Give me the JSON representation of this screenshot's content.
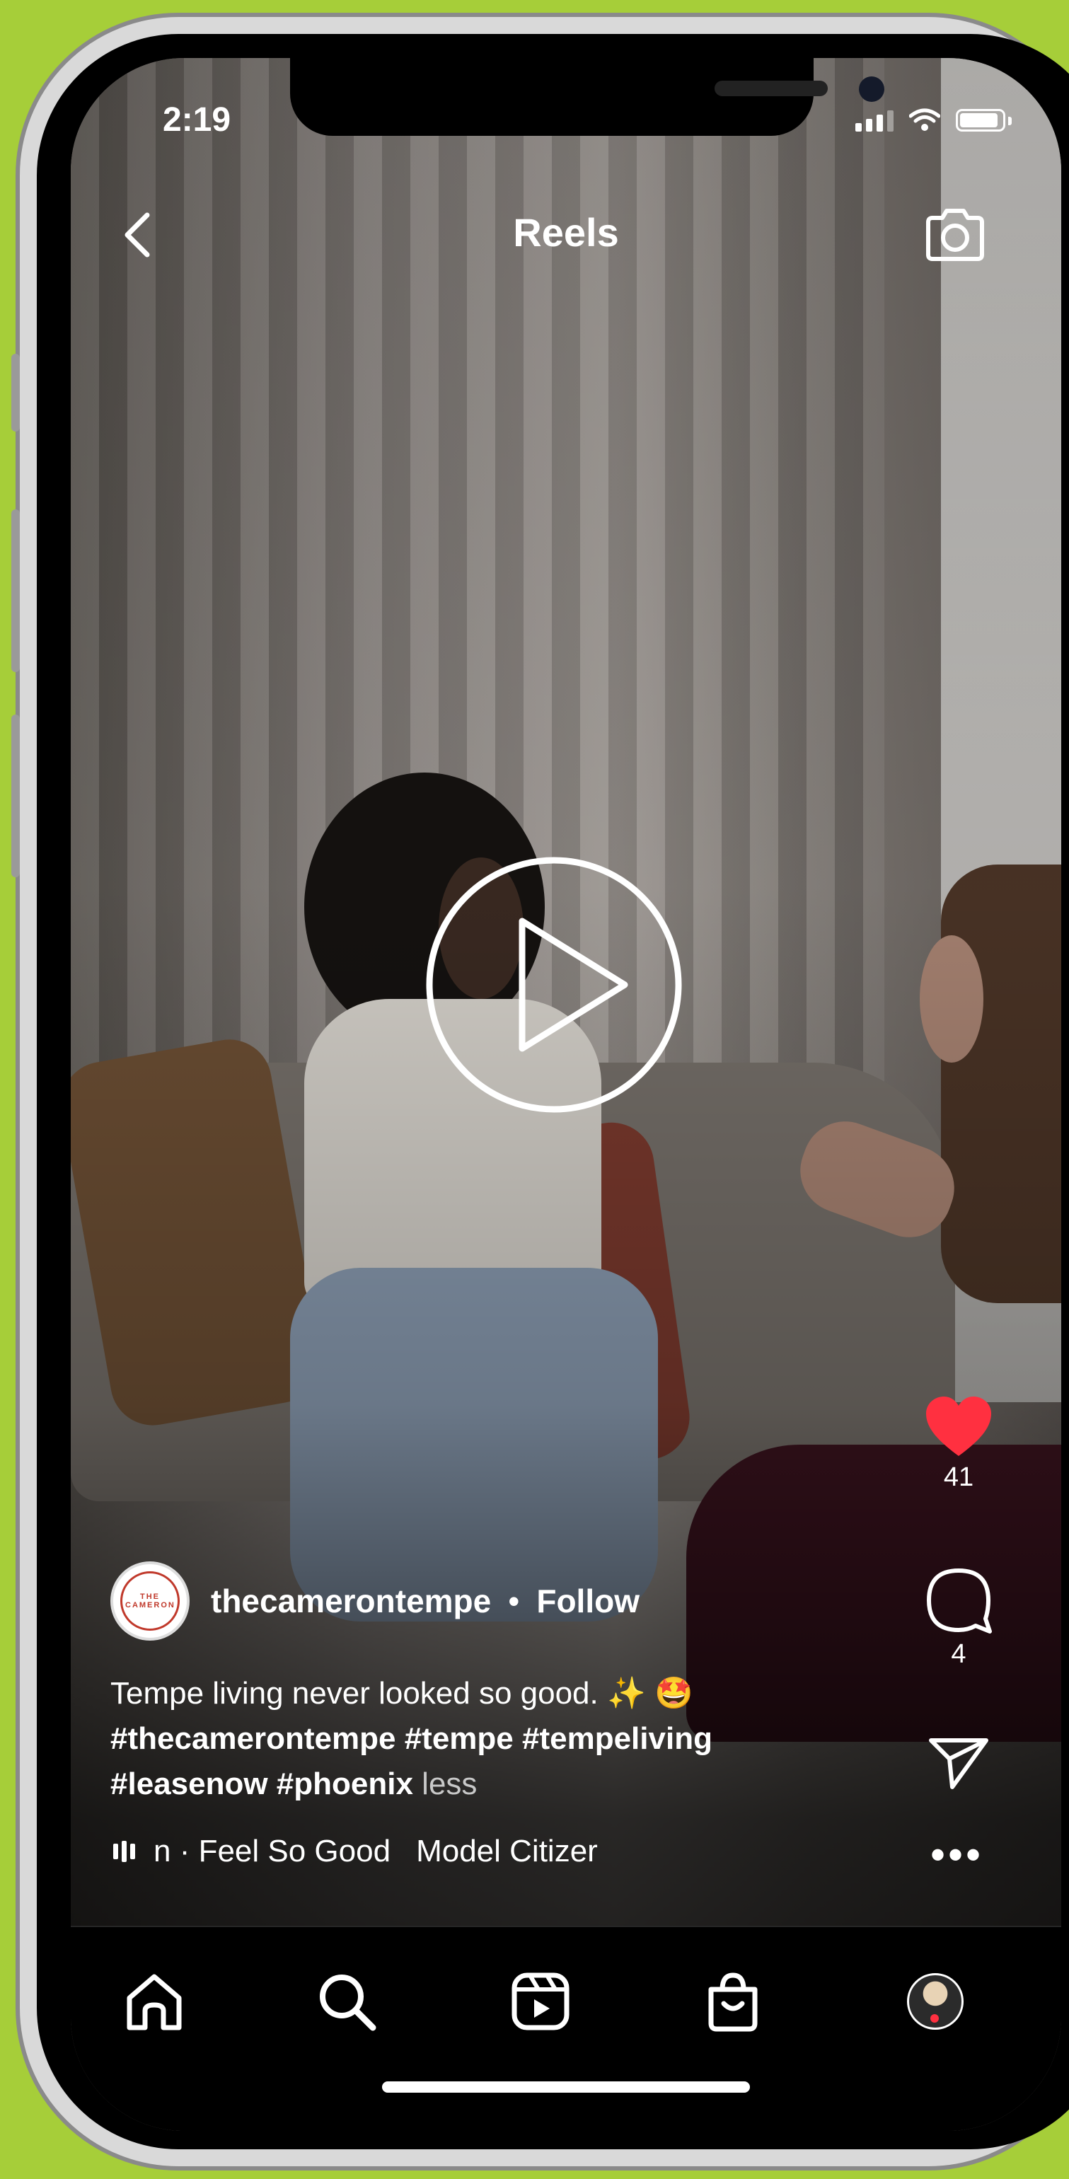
{
  "status_bar": {
    "time": "2:19"
  },
  "header": {
    "title": "Reels",
    "back_icon": "chevron-left-icon",
    "camera_icon": "camera-icon"
  },
  "video": {
    "play_icon": "play-icon"
  },
  "actions": {
    "likes": "41",
    "comments": "4",
    "like_color": "#ff3040"
  },
  "post": {
    "username": "thecamerontempe",
    "separator": "•",
    "follow_label": "Follow",
    "avatar_text": "THE CAMERON",
    "caption_text": "Tempe living never looked so good. ✨ 🤩",
    "caption_tags_line1": "#thecamerontempe #tempe #tempeliving",
    "caption_tags_line2": "#leasenow #phoenix",
    "less_label": "less"
  },
  "audio": {
    "text": "n · Feel So Good",
    "text_dim": "Model Citizer"
  },
  "tabbar": {
    "items": [
      "home-icon",
      "search-icon",
      "reels-icon",
      "shop-icon",
      "profile-avatar"
    ]
  },
  "colors": {
    "background": "#a6ce39",
    "accent": "#ff3040"
  }
}
